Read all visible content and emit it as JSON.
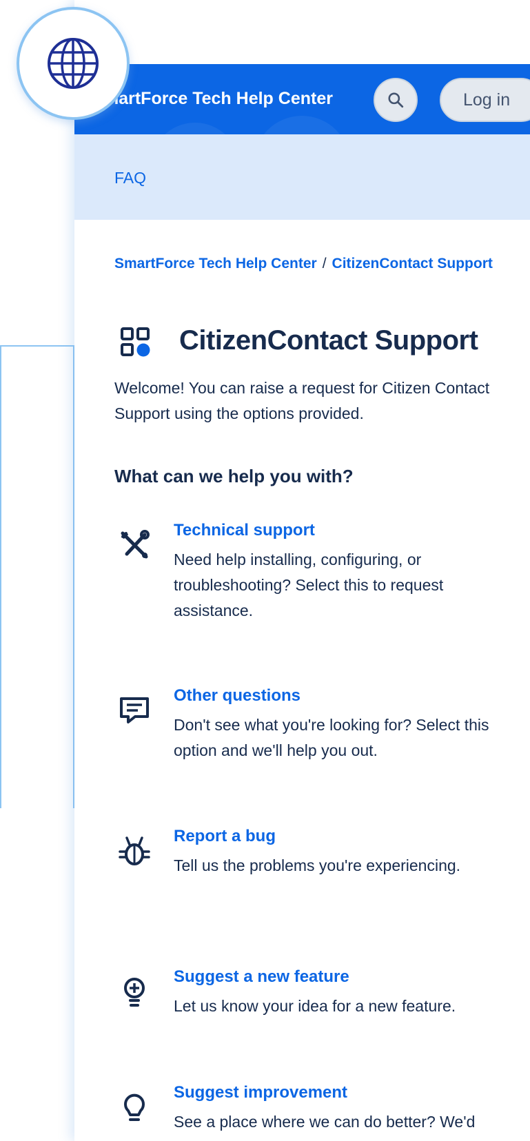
{
  "header": {
    "title": "martForce Tech Help Center",
    "login_label": "Log in",
    "search_icon": "search-icon"
  },
  "nav": {
    "faq_label": "FAQ"
  },
  "breadcrumb": {
    "home": "SmartForce Tech Help Center",
    "separator": "/",
    "current": "CitizenContact Support"
  },
  "portal": {
    "title": "CitizenContact Support",
    "welcome": "Welcome! You can raise a request for Citizen Contact Support using the options provided."
  },
  "help_heading": "What can we help you with?",
  "request_types": [
    {
      "icon": "tools-icon",
      "name": "Technical support",
      "description": "Need help installing, configuring, or troubleshooting? Select this to request assistance."
    },
    {
      "icon": "comment-icon",
      "name": "Other questions",
      "description": "Don't see what you're looking for? Select this option and we'll help you out."
    },
    {
      "icon": "bug-icon",
      "name": "Report a bug",
      "description": "Tell us the problems you're experiencing."
    },
    {
      "icon": "lightbulb-plus-icon",
      "name": "Suggest a new feature",
      "description": "Let us know your idea for a new feature."
    },
    {
      "icon": "lightbulb-icon",
      "name": "Suggest improvement",
      "description": "See a place where we can do better? We'd love to hear about it."
    }
  ],
  "colors": {
    "brand_blue": "#0c66e4",
    "subnav_bg": "#dbe9fb",
    "text": "#172b4d",
    "frame_accent": "#8cc4f2"
  }
}
